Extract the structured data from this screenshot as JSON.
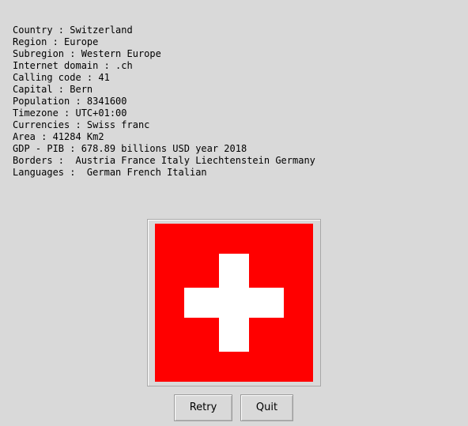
{
  "info": {
    "lines": [
      "Country : Switzerland",
      "Region : Europe",
      "Subregion : Western Europe",
      "Internet domain : .ch",
      "Calling code : 41",
      "Capital : Bern",
      "Population : 8341600",
      "Timezone : UTC+01:00",
      "Currencies : Swiss franc",
      "Area : 41284 Km2",
      "GDP - PIB : 678.89 billions USD year 2018",
      "Borders :  Austria France Italy Liechtenstein Germany",
      "Languages :  German French Italian"
    ]
  },
  "flag": {
    "field_color": "#ff0000",
    "cross_color": "#ffffff"
  },
  "buttons": {
    "retry_label": "Retry",
    "quit_label": "Quit"
  }
}
